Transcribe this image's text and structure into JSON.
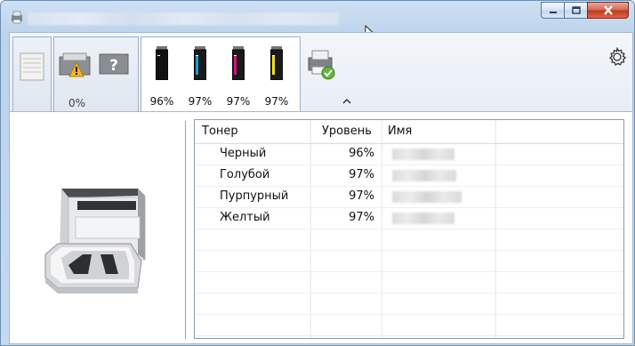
{
  "window": {
    "title": ""
  },
  "toolbar": {
    "tray_status": "0%",
    "toners": [
      {
        "color_name": "black",
        "color": "#1a1a1a",
        "level": "96%"
      },
      {
        "color_name": "cyan",
        "color": "#1e9bd7",
        "level": "97%"
      },
      {
        "color_name": "magenta",
        "color": "#d6127a",
        "level": "97%"
      },
      {
        "color_name": "yellow",
        "color": "#f0e020",
        "level": "97%"
      }
    ]
  },
  "table": {
    "headers": {
      "toner": "Тонер",
      "level": "Уровень",
      "name": "Имя"
    },
    "rows": [
      {
        "toner": "Черный",
        "level": "96%"
      },
      {
        "toner": "Голубой",
        "level": "97%"
      },
      {
        "toner": "Пурпурный",
        "level": "97%"
      },
      {
        "toner": "Желтый",
        "level": "97%"
      }
    ]
  }
}
